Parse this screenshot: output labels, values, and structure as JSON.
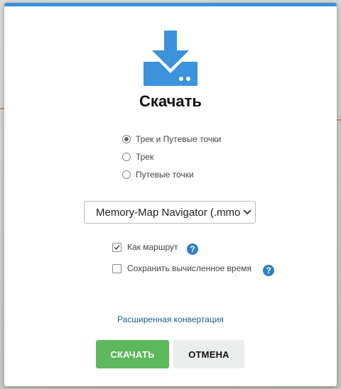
{
  "dialog": {
    "title": "Скачать",
    "icon": "download-icon",
    "accent_color": "#3b8fd9"
  },
  "format_options": [
    {
      "label": "Трек и Путевые точки",
      "checked": true
    },
    {
      "label": "Трек",
      "checked": false
    },
    {
      "label": "Путевые точки",
      "checked": false
    }
  ],
  "format_select": {
    "value": "Memory-Map Navigator (.mmo)"
  },
  "options": {
    "as_route": {
      "label": "Как маршрут",
      "checked": true
    },
    "save_time": {
      "label": "Сохранить вычисленное время",
      "checked": false
    }
  },
  "advanced_link": "Расширенная конвертация",
  "buttons": {
    "download": "СКАЧАТЬ",
    "cancel": "ОТМЕНА",
    "download_color": "#5cb85c"
  }
}
